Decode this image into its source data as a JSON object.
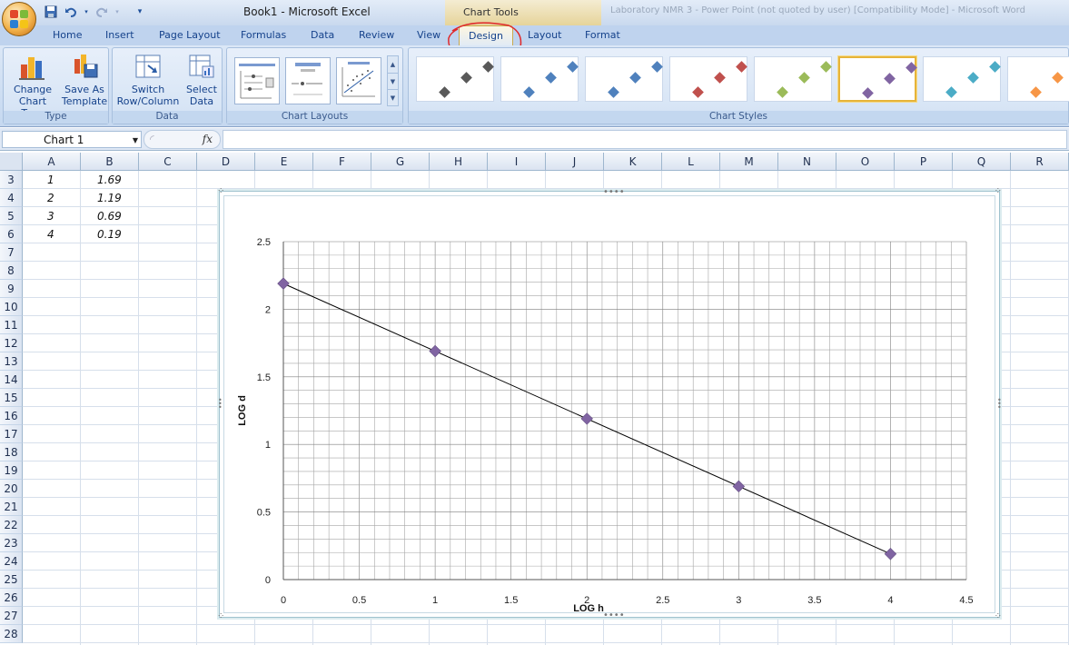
{
  "window": {
    "title": "Book1 - Microsoft Excel",
    "context_tab_group": "Chart Tools",
    "blurred_text": "Laboratory NMR 3 - Power Point (not quoted by user) [Compatibility Mode] - Microsoft Word"
  },
  "quick_access": [
    "save-icon",
    "undo-icon",
    "redo-icon",
    "customize-icon"
  ],
  "tabs": [
    "Home",
    "Insert",
    "Page Layout",
    "Formulas",
    "Data",
    "Review",
    "View",
    "Design",
    "Layout",
    "Format"
  ],
  "active_tab": "Design",
  "ribbon": {
    "type_group": {
      "label": "Type",
      "change_chart_type": "Change Chart Type",
      "change_chart_type_line1": "Change",
      "change_chart_type_line2": "Chart Type",
      "save_as_template_line1": "Save As",
      "save_as_template_line2": "Template"
    },
    "data_group": {
      "label": "Data",
      "switch_line1": "Switch",
      "switch_line2": "Row/Column",
      "select_line1": "Select",
      "select_line2": "Data"
    },
    "layouts_group": {
      "label": "Chart Layouts"
    },
    "styles_group": {
      "label": "Chart Styles",
      "colors": [
        "#595959",
        "#4f81bd",
        "#4f81bd",
        "#c0504d",
        "#9bbb59",
        "#8064a2",
        "#4bacc6",
        "#f79646"
      ],
      "selected_index": 5
    }
  },
  "formula_bar": {
    "name_box": "Chart 1",
    "fx": "fx",
    "formula": ""
  },
  "sheet": {
    "columns": [
      "A",
      "B",
      "C",
      "D",
      "E",
      "F",
      "G",
      "H",
      "I",
      "J",
      "K",
      "L",
      "M",
      "N",
      "O",
      "P",
      "Q",
      "R"
    ],
    "rows": [
      "3",
      "4",
      "5",
      "6",
      "7",
      "8",
      "9",
      "10",
      "11",
      "12",
      "13",
      "14",
      "15",
      "16",
      "17",
      "18",
      "19",
      "20",
      "21",
      "22",
      "23",
      "24",
      "25",
      "26",
      "27",
      "28"
    ],
    "cells": [
      {
        "a": "1",
        "b": "1.69"
      },
      {
        "a": "2",
        "b": "1.19"
      },
      {
        "a": "3",
        "b": "0.69"
      },
      {
        "a": "4",
        "b": "0.19"
      }
    ]
  },
  "chart_data": {
    "type": "scatter",
    "title": "",
    "xlabel": "LOG h",
    "ylabel": "LOG d",
    "xlim": [
      0,
      4.5
    ],
    "ylim": [
      0,
      2.5
    ],
    "x_ticks": [
      "0",
      "0.5",
      "1",
      "1.5",
      "2",
      "2.5",
      "3",
      "3.5",
      "4",
      "4.5"
    ],
    "y_ticks": [
      "0",
      "0.5",
      "1",
      "1.5",
      "2",
      "2.5"
    ],
    "grid": true,
    "legend": "none",
    "marker_color": "#8064a2",
    "series": [
      {
        "x": [
          0,
          1,
          2,
          3,
          4
        ],
        "y": [
          2.19,
          1.69,
          1.19,
          0.69,
          0.19
        ]
      }
    ],
    "trendline": {
      "x": [
        0,
        4
      ],
      "y": [
        2.19,
        0.19
      ],
      "color": "#000000"
    }
  }
}
